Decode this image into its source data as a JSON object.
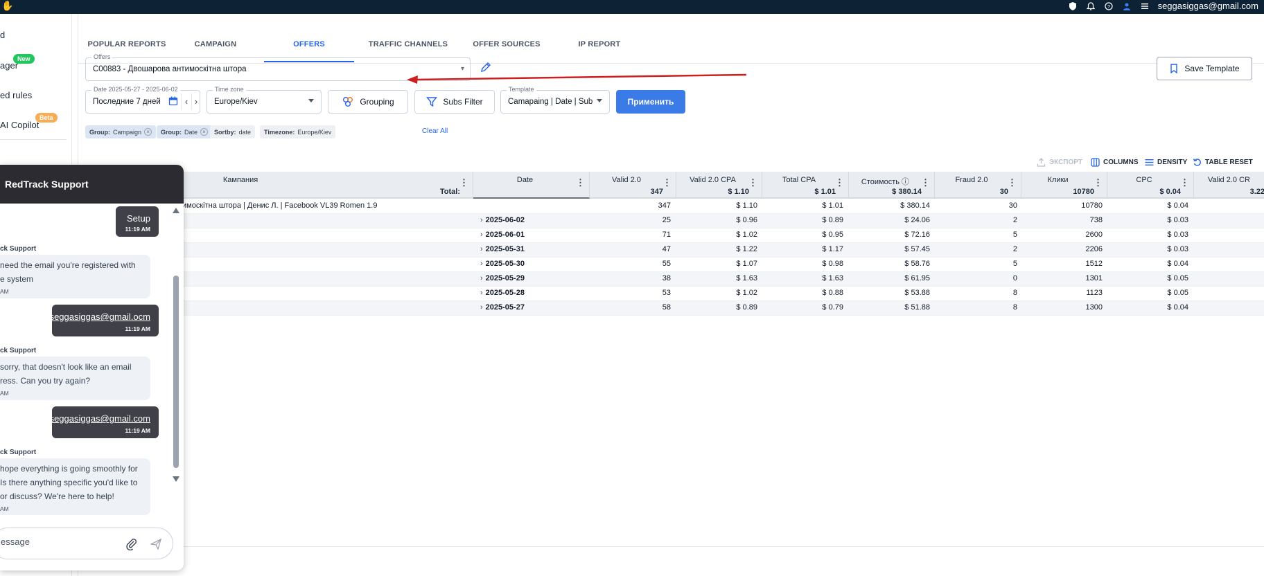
{
  "topbar": {
    "user_email": "seggasiggas@gmail.com",
    "colors": {
      "background": "#0d2235"
    }
  },
  "sidebar": {
    "items": [
      {
        "label": "d"
      },
      {
        "label": "ager",
        "badge": "New"
      },
      {
        "label": "ed rules"
      },
      {
        "label": "AI Copilot",
        "badge": "Beta"
      }
    ]
  },
  "tabs": [
    {
      "label": "POPULAR REPORTS",
      "active": false
    },
    {
      "label": "CAMPAIGN",
      "active": false
    },
    {
      "label": "OFFERS",
      "active": true
    },
    {
      "label": "TRAFFIC CHANNELS",
      "active": false
    },
    {
      "label": "OFFER SOURCES",
      "active": false
    },
    {
      "label": "IP REPORT",
      "active": false
    }
  ],
  "filters": {
    "offers": {
      "label": "Offers",
      "value": "C00883 - Двошарова антимоскітна штора"
    },
    "save_template_label": "Save Template",
    "date": {
      "label": "Date 2025-05-27 - 2025-06-02",
      "value": "Последние 7 дней"
    },
    "timezone": {
      "label": "Time zone",
      "value": "Europe/Kiev"
    },
    "grouping_label": "Grouping",
    "subs_filter_label": "Subs Filter",
    "template": {
      "label": "Template",
      "value": "Camapaing | Date | Sub"
    },
    "apply_label": "Применить"
  },
  "chips": [
    {
      "key": "Group:",
      "value": "Campaign",
      "removable": true,
      "style": "blue"
    },
    {
      "key": "Group:",
      "value": "Date",
      "removable": true,
      "style": "blue"
    },
    {
      "key": "Sortby:",
      "value": "date",
      "removable": false,
      "style": "gray"
    },
    {
      "key": "Timezone:",
      "value": "Europe/Kiev",
      "removable": false,
      "style": "gray"
    }
  ],
  "clear_all_label": "Clear All",
  "table_actions": {
    "export": "ЭКСПОРТ",
    "columns": "COLUMNS",
    "density": "DENSITY",
    "reset": "TABLE RESET"
  },
  "table": {
    "columns": [
      {
        "name": "Кампания",
        "total": "Total:"
      },
      {
        "name": "Date",
        "total": ""
      },
      {
        "name": "Valid 2.0",
        "total": "347"
      },
      {
        "name": "Valid 2.0 CPA",
        "total": "$ 1.10"
      },
      {
        "name": "Total CPA",
        "total": "$ 1.01"
      },
      {
        "name": "Стоимость ⓘ",
        "total": "$ 380.14"
      },
      {
        "name": "Fraud 2.0",
        "total": "30"
      },
      {
        "name": "Клики",
        "total": "10780"
      },
      {
        "name": "CPC",
        "total": "$ 0.04"
      },
      {
        "name": "Valid 2.0 CR",
        "total": "3.22"
      }
    ],
    "group_row": {
      "campaign": "имоскітна штора | Денис Л. | Facebook VL39 Romen 1.9",
      "values": [
        "347",
        "$ 1.10",
        "$ 1.01",
        "$ 380.14",
        "30",
        "10780",
        "$ 0.04"
      ]
    },
    "rows": [
      {
        "date": "2025-06-02",
        "values": [
          "25",
          "$ 0.96",
          "$ 0.89",
          "$ 24.06",
          "2",
          "738",
          "$ 0.03"
        ]
      },
      {
        "date": "2025-06-01",
        "values": [
          "71",
          "$ 1.02",
          "$ 0.95",
          "$ 72.16",
          "5",
          "2600",
          "$ 0.03"
        ]
      },
      {
        "date": "2025-05-31",
        "values": [
          "47",
          "$ 1.22",
          "$ 1.17",
          "$ 57.45",
          "2",
          "2206",
          "$ 0.03"
        ]
      },
      {
        "date": "2025-05-30",
        "values": [
          "55",
          "$ 1.07",
          "$ 0.98",
          "$ 58.76",
          "5",
          "1512",
          "$ 0.04"
        ]
      },
      {
        "date": "2025-05-29",
        "values": [
          "38",
          "$ 1.63",
          "$ 1.63",
          "$ 61.95",
          "0",
          "1301",
          "$ 0.05"
        ]
      },
      {
        "date": "2025-05-28",
        "values": [
          "53",
          "$ 1.02",
          "$ 0.88",
          "$ 53.88",
          "8",
          "1123",
          "$ 0.05"
        ]
      },
      {
        "date": "2025-05-27",
        "values": [
          "58",
          "$ 0.89",
          "$ 0.79",
          "$ 51.88",
          "8",
          "1300",
          "$ 0.04"
        ]
      }
    ]
  },
  "chat": {
    "title": "RedTrack Support",
    "messages": [
      {
        "from": "user",
        "text": "Setup",
        "time": "11:19 AM"
      },
      {
        "from": "support",
        "sender": "ck Support",
        "lines": [
          "need the email you're registered with",
          "e system"
        ],
        "time": "AM"
      },
      {
        "from": "user",
        "text": "seggasiggas@gmail.ocm",
        "time": "11:19 AM"
      },
      {
        "from": "support",
        "sender": "ck Support",
        "lines": [
          "sorry, that doesn't look like an email",
          "ress. Can you try again?"
        ],
        "time": "AM"
      },
      {
        "from": "user",
        "text": "seggasiggas@gmail.com",
        "time": "11:19 AM"
      },
      {
        "from": "support",
        "sender": "ck Support",
        "lines": [
          "hope everything is going smoothly for",
          " Is there anything specific you'd like to",
          "or discuss? We're here to help!"
        ],
        "time": "AM"
      }
    ],
    "input_placeholder": "essage"
  },
  "colors": {
    "accent": "#2563eb",
    "primary_button": "#3b7be8",
    "annotation_arrow": "#cc1f1f",
    "new_badge": "#22c55e",
    "beta_badge": "#f6ad55"
  },
  "icons": {
    "topbar": [
      "shield-icon",
      "bell-icon",
      "help-icon",
      "user-icon",
      "menu-icon"
    ],
    "filters": [
      "pencil-icon",
      "bookmark-icon",
      "calendar-icon",
      "grouping-icon",
      "filter-icon"
    ],
    "table_actions": [
      "export-icon",
      "columns-icon",
      "density-icon",
      "reset-icon"
    ],
    "chat": [
      "paperclip-icon",
      "send-icon"
    ]
  }
}
